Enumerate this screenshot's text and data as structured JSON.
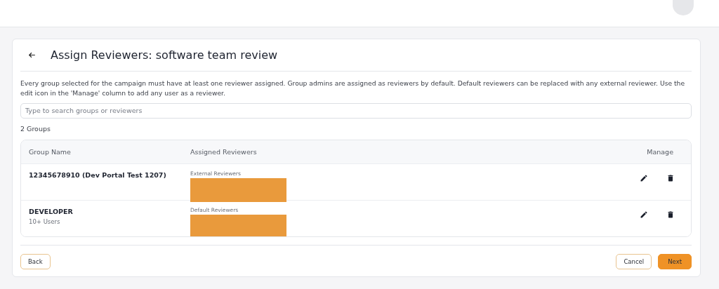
{
  "page": {
    "title": "Assign Reviewers: software team review",
    "description": "Every group selected for the campaign must have at least one reviewer assigned. Group admins are assigned as reviewers by default. Default reviewers can be replaced with any external reviewer. Use the edit icon in the 'Manage' column to add any user as a reviewer.",
    "search": {
      "placeholder": "Type to search groups or reviewers"
    },
    "count": "2 Groups"
  },
  "table": {
    "columns": [
      "Group Name",
      "Assigned Reviewers",
      "Manage"
    ],
    "rows": [
      {
        "name": "12345678910 (Dev Portal Test 1207)",
        "reviewer_label": "External Reviewers"
      },
      {
        "name": "DEVELOPER",
        "subtitle": "10+ Users",
        "reviewer_label": "Default Reviewers"
      }
    ]
  },
  "buttons": {
    "back": "Back",
    "cancel": "Cancel",
    "next": "Next"
  }
}
